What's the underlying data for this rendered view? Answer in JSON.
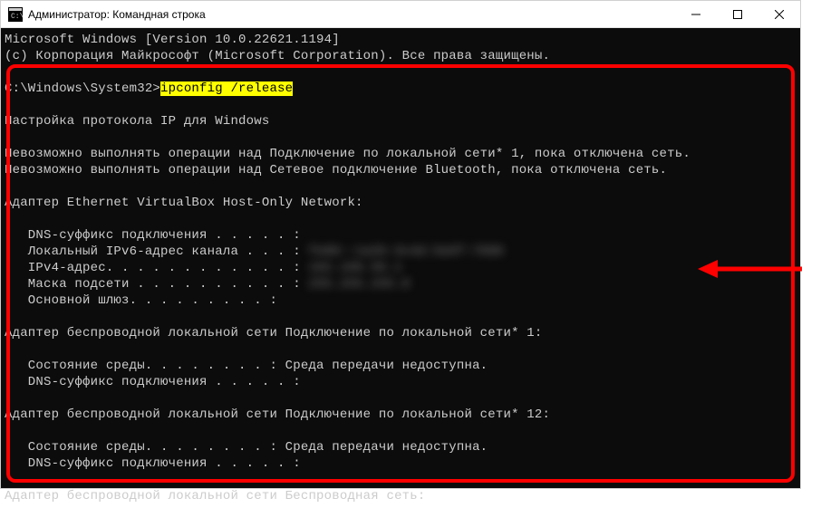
{
  "window": {
    "title": "Администратор: Командная строка"
  },
  "terminal": {
    "header1": "Microsoft Windows [Version 10.0.22621.1194]",
    "header2": "(c) Корпорация Майкрософт (Microsoft Corporation). Все права защищены.",
    "prompt": "C:\\Windows\\System32>",
    "command": "ipconfig /release",
    "cfgTitle": "Настройка протокола IP для Windows",
    "err1": "Невозможно выполнять операции над Подключение по локальной сети* 1, пока отключена сеть.",
    "err2": "Невозможно выполнять операции над Сетевое подключение Bluetooth, пока отключена сеть.",
    "adapter1": {
      "title": "Адаптер Ethernet VirtualBox Host-Only Network:",
      "dns": "   DNS-суффикс подключения . . . . . :",
      "ipv6": "   Локальный IPv6-адрес канала . . . : ",
      "ipv6v": "fe80::1a2b:3c4d:5e6f:7890",
      "ipv4": "   IPv4-адрес. . . . . . . . . . . . : ",
      "ipv4v": "192.168.56.1",
      "mask": "   Маска подсети . . . . . . . . . . : ",
      "maskv": "255.255.255.0",
      "gw": "   Основной шлюз. . . . . . . . . :"
    },
    "adapter2": {
      "title": "Адаптер беспроводной локальной сети Подключение по локальной сети* 1:",
      "state": "   Состояние среды. . . . . . . . : Среда передачи недоступна.",
      "dns": "   DNS-суффикс подключения . . . . . :"
    },
    "adapter3": {
      "title": "Адаптер беспроводной локальной сети Подключение по локальной сети* 12:",
      "state": "   Состояние среды. . . . . . . . : Среда передачи недоступна.",
      "dns": "   DNS-суффикс подключения . . . . . :"
    },
    "adapter4": {
      "title": "Адаптер беспроводной локальной сети Беспроводная сеть:"
    }
  }
}
